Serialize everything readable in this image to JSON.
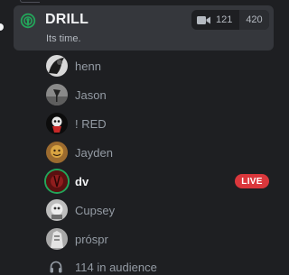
{
  "channel": {
    "name": "DRILL",
    "topic": "Its time.",
    "video_count": "121",
    "user_limit": "420",
    "icon": "stage-icon"
  },
  "speakers": [
    {
      "name": "henn",
      "icon": "avatar"
    },
    {
      "name": "Jason",
      "icon": "avatar"
    },
    {
      "name": "! RED",
      "icon": "avatar"
    },
    {
      "name": "Jayden",
      "icon": "avatar"
    },
    {
      "name": "dv",
      "icon": "avatar",
      "live": "LIVE"
    },
    {
      "name": "Cupsey",
      "icon": "avatar"
    },
    {
      "name": "prospr",
      "display": "próspr",
      "icon": "avatar"
    }
  ],
  "audience": {
    "text": "114 in audience",
    "icon": "headphones-icon"
  },
  "colors": {
    "background": "#1e1f22",
    "card": "#35373c",
    "live": "#da373c",
    "speaking": "#23a55a"
  }
}
